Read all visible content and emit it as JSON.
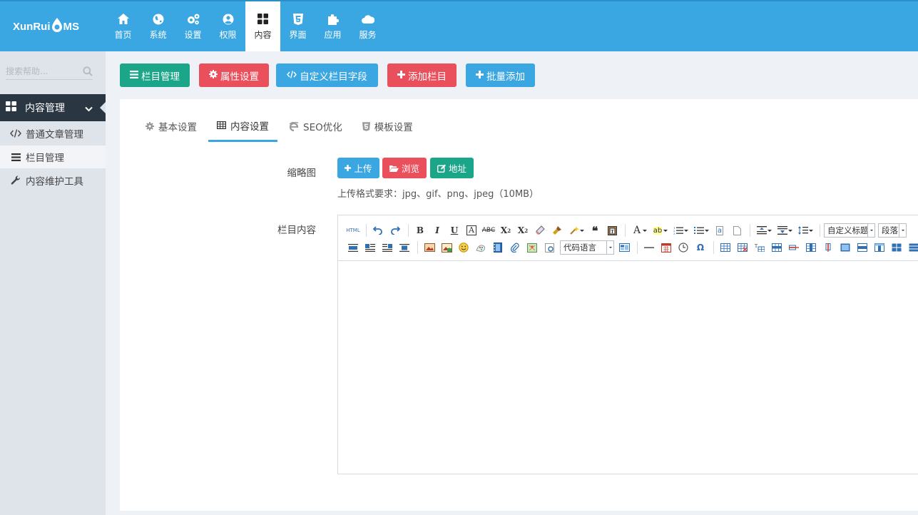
{
  "brand": {
    "logo_text_left": "XunRui",
    "logo_text_right": "MS"
  },
  "nav": [
    {
      "label": "首页",
      "icon": "home-icon"
    },
    {
      "label": "系统",
      "icon": "globe-icon"
    },
    {
      "label": "设置",
      "icon": "gears-icon"
    },
    {
      "label": "权限",
      "icon": "user-circle-icon"
    },
    {
      "label": "内容",
      "icon": "grid-icon",
      "active": true
    },
    {
      "label": "界面",
      "icon": "html5-icon"
    },
    {
      "label": "应用",
      "icon": "puzzle-icon"
    },
    {
      "label": "服务",
      "icon": "cloud-icon"
    }
  ],
  "sidebar": {
    "search_placeholder": "搜索帮助...",
    "group_label": "内容管理",
    "items": [
      {
        "label": "普通文章管理",
        "icon": "code-icon"
      },
      {
        "label": "栏目管理",
        "icon": "list-icon",
        "active": true
      },
      {
        "label": "内容维护工具",
        "icon": "wrench-icon"
      }
    ]
  },
  "toolbar": {
    "buttons": [
      {
        "label": "栏目管理",
        "icon": "list-icon",
        "color": "#1ba589"
      },
      {
        "label": "属性设置",
        "icon": "gear-icon",
        "color": "#e9505c"
      },
      {
        "label": "自定义栏目字段",
        "icon": "code-icon",
        "color": "#3ba7e2"
      },
      {
        "label": "添加栏目",
        "icon": "plus-icon",
        "color": "#e9505c"
      },
      {
        "label": "批量添加",
        "icon": "plus-icon",
        "color": "#3ba7e2"
      }
    ]
  },
  "tabs": [
    {
      "label": "基本设置",
      "icon": "gear-icon"
    },
    {
      "label": "内容设置",
      "icon": "table-icon",
      "active": true
    },
    {
      "label": "SEO优化",
      "icon": "ie-icon"
    },
    {
      "label": "模板设置",
      "icon": "html5-icon"
    }
  ],
  "form": {
    "thumb_label": "缩略图",
    "upload_label": "上传",
    "browse_label": "浏览",
    "address_label": "地址",
    "format_hint": "上传格式要求：jpg、gif、png、jpeg（10MB）",
    "content_label": "栏目内容"
  },
  "editor": {
    "html_label": "HTML",
    "custom_title_option": "自定义标题",
    "paragraph_option": "段落",
    "code_language_option": "代码语言"
  }
}
